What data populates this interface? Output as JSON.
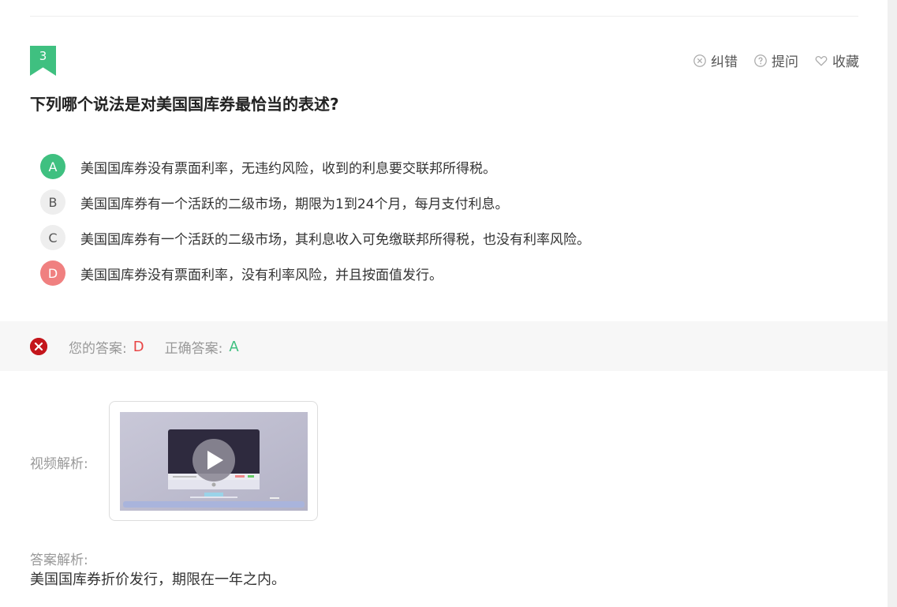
{
  "question": {
    "number": "3",
    "text": "下列哪个说法是对美国国库券最恰当的表述?"
  },
  "tools": {
    "report_label": "纠错",
    "ask_label": "提问",
    "favorite_label": "收藏"
  },
  "options": [
    {
      "letter": "A",
      "text": "美国国库券没有票面利率，无违约风险，收到的利息要交联邦所得税。",
      "state": "correct"
    },
    {
      "letter": "B",
      "text": "美国国库券有一个活跃的二级市场，期限为1到24个月，每月支付利息。",
      "state": "normal"
    },
    {
      "letter": "C",
      "text": "美国国库券有一个活跃的二级市场，其利息收入可免缴联邦所得税，也没有利率风险。",
      "state": "normal"
    },
    {
      "letter": "D",
      "text": "美国国库券没有票面利率，没有利率风险，并且按面值发行。",
      "state": "wrong"
    }
  ],
  "answer": {
    "your_label": "您的答案:",
    "your_value": "D",
    "correct_label": "正确答案:",
    "correct_value": "A"
  },
  "video": {
    "label": "视频解析:"
  },
  "analysis": {
    "label": "答案解析:",
    "text": "美国国库券折价发行，期限在一年之内。"
  },
  "colors": {
    "accent_green": "#3fc080",
    "wrong_red": "#f08080",
    "error_icon": "#c4161c"
  }
}
